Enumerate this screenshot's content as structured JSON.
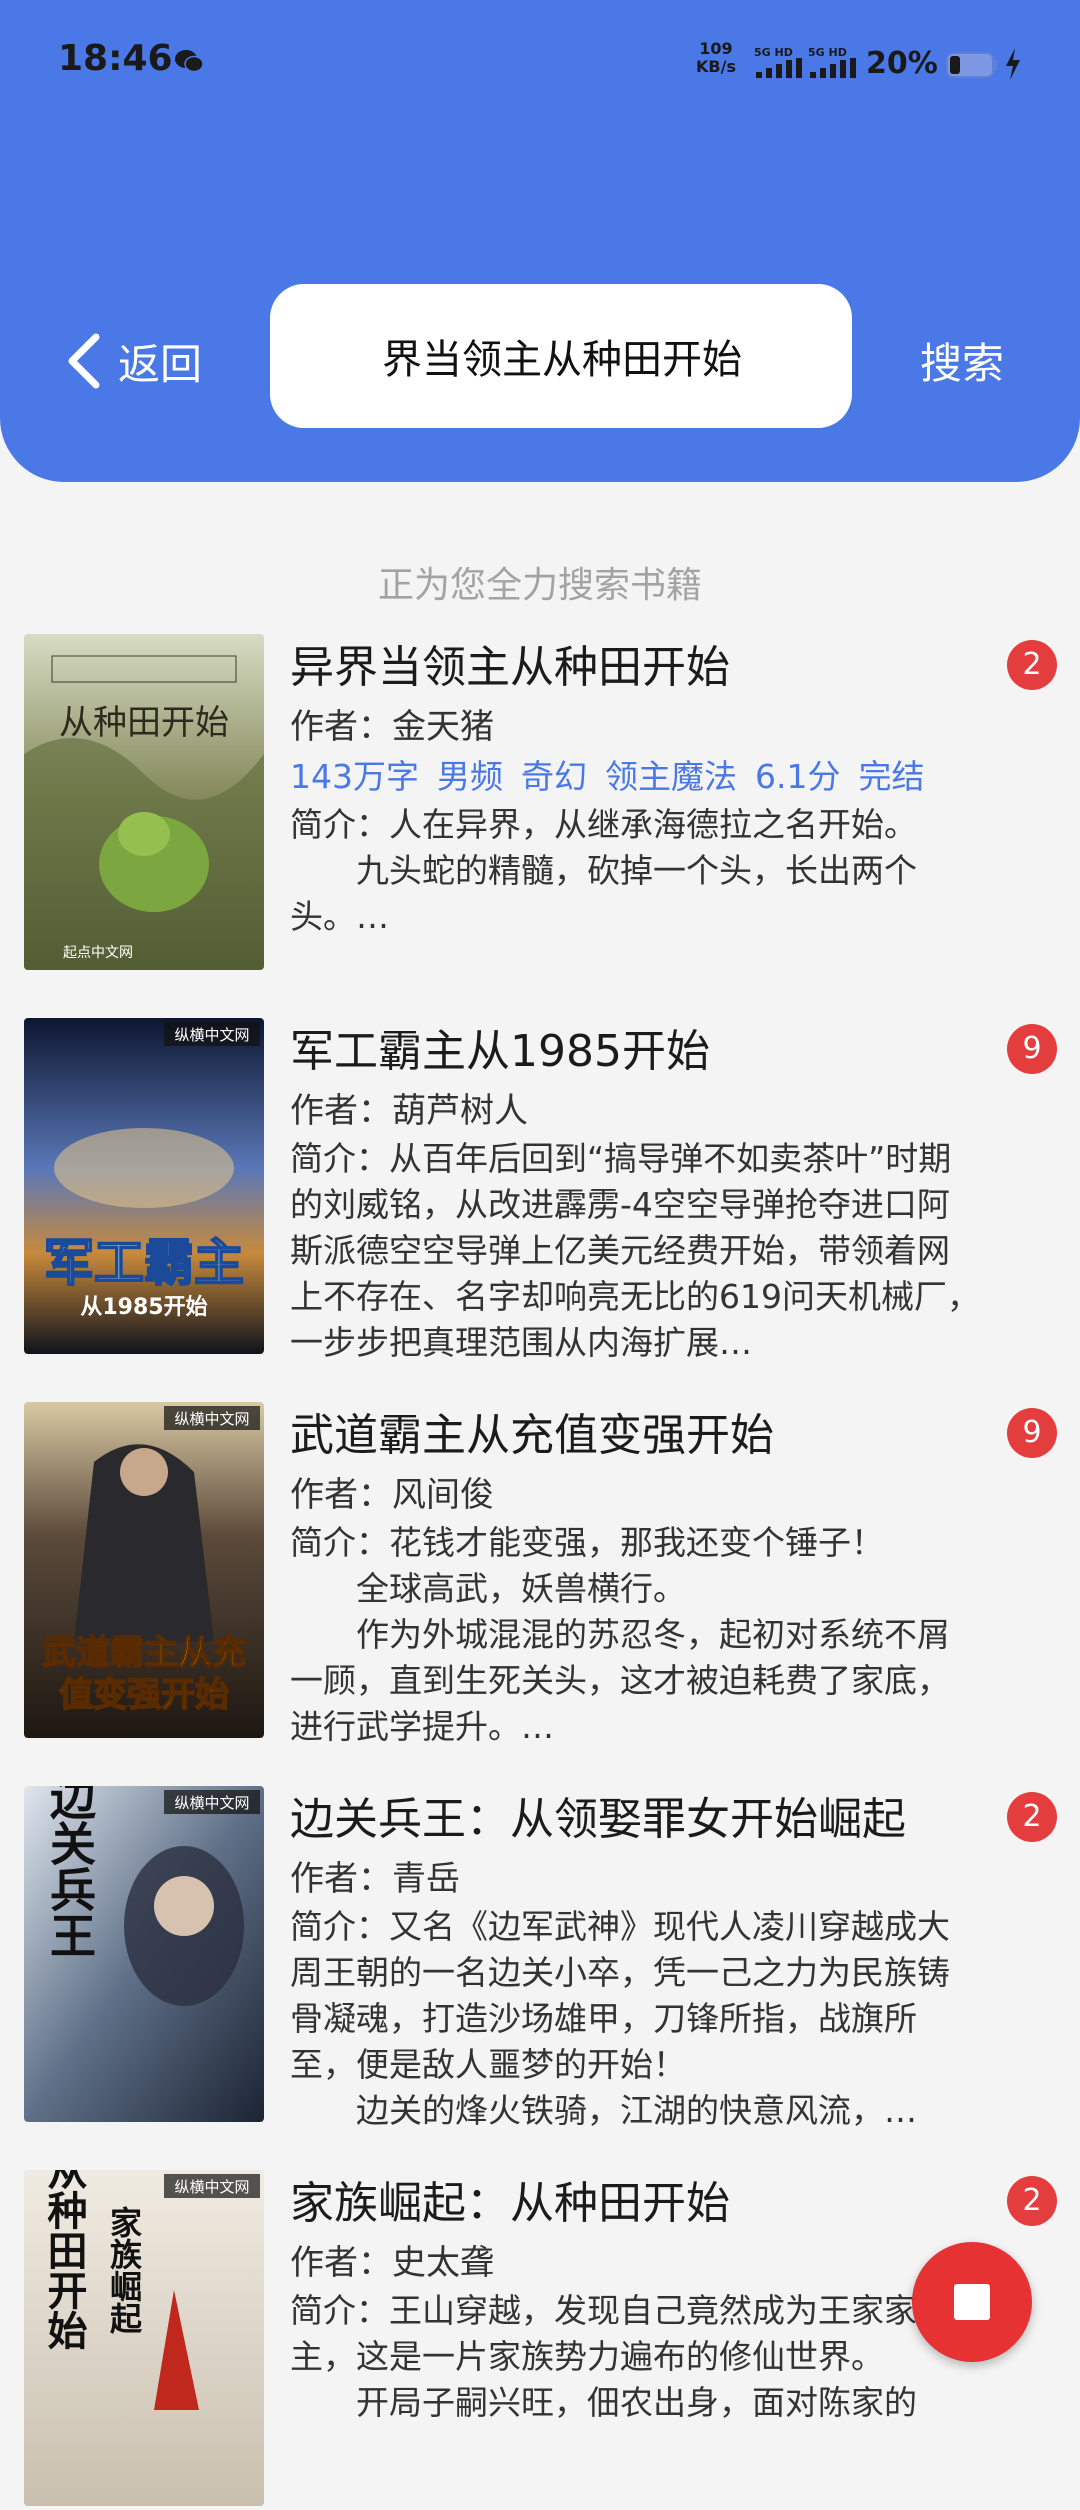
{
  "status_bar": {
    "time": "18:46",
    "net_speed_value": "109",
    "net_speed_unit": "KB/s",
    "signal1_label": "5G HD",
    "signal2_label": "5G HD",
    "battery": "20%"
  },
  "header": {
    "back_label": "返回",
    "search_value": "界当领主从种田开始",
    "search_button": "搜索"
  },
  "status_message": "正为您全力搜索书籍",
  "books": [
    {
      "title": "异界当领主从种田开始",
      "author": "作者：金天猪",
      "tags": [
        "143万字",
        "男频",
        "奇幻",
        "领主魔法",
        "6.1分",
        "完结"
      ],
      "intro": "简介：人在异界，从继承海德拉之名开始。\n　　九头蛇的精髓，砍掉一个头，长出两个头。…",
      "badge": "2",
      "cover_title": "从种田开始",
      "cover_publisher": "起点中文网"
    },
    {
      "title": "军工霸主从1985开始",
      "author": "作者：葫芦树人",
      "tags": [],
      "intro": "简介：从百年后回到“搞导弹不如卖茶叶”时期的刘威铭，从改进霹雳-4空空导弹抢夺进口阿斯派德空空导弹上亿美元经费开始，带领着网上不存在、名字却响亮无比的619问天机械厂，一步步把真理范围从内海扩展…",
      "badge": "9",
      "cover_title": "军工霸主",
      "cover_subtitle": "从1985开始",
      "cover_publisher": "纵横中文网"
    },
    {
      "title": "武道霸主从充值变强开始",
      "author": "作者：风间俊",
      "tags": [],
      "intro": "简介：花钱才能变强，那我还变个锤子！\n　　全球高武，妖兽横行。\n　　作为外城混混的苏忍冬，起初对系统不屑一顾，直到生死关头，这才被迫耗费了家底，进行武学提升。…",
      "badge": "9",
      "cover_title": "武道霸主从充",
      "cover_subtitle": "值变强开始",
      "cover_publisher": "纵横中文网"
    },
    {
      "title": "边关兵王：从领娶罪女开始崛起",
      "author": "作者：青岳",
      "tags": [],
      "intro": "简介：又名《边军武神》现代人凌川穿越成大周王朝的一名边关小卒，凭一己之力为民族铸骨凝魂，打造沙场雄甲，刀锋所指，战旗所至，便是敌人噩梦的开始！\n　　边关的烽火铁骑，江湖的快意风流，…",
      "badge": "2",
      "cover_title": "边关兵王",
      "cover_publisher": "纵横中文网"
    },
    {
      "title": "家族崛起：从种田开始",
      "author": "作者：史太聋",
      "tags": [],
      "intro": "简介：王山穿越，发现自己竟然成为王家家主，这是一片家族势力遍布的修仙世界。\n　　开局子嗣兴旺，佃农出身，面对陈家的",
      "badge": "2",
      "cover_title": "从种田开始",
      "cover_subtitle": "家族崛起",
      "cover_publisher": "纵横中文网"
    }
  ],
  "colors": {
    "header_bg": "#4a78e6",
    "tag_blue": "#4a78e6",
    "badge_red": "#e33d3d",
    "fab_red": "#e63232"
  }
}
